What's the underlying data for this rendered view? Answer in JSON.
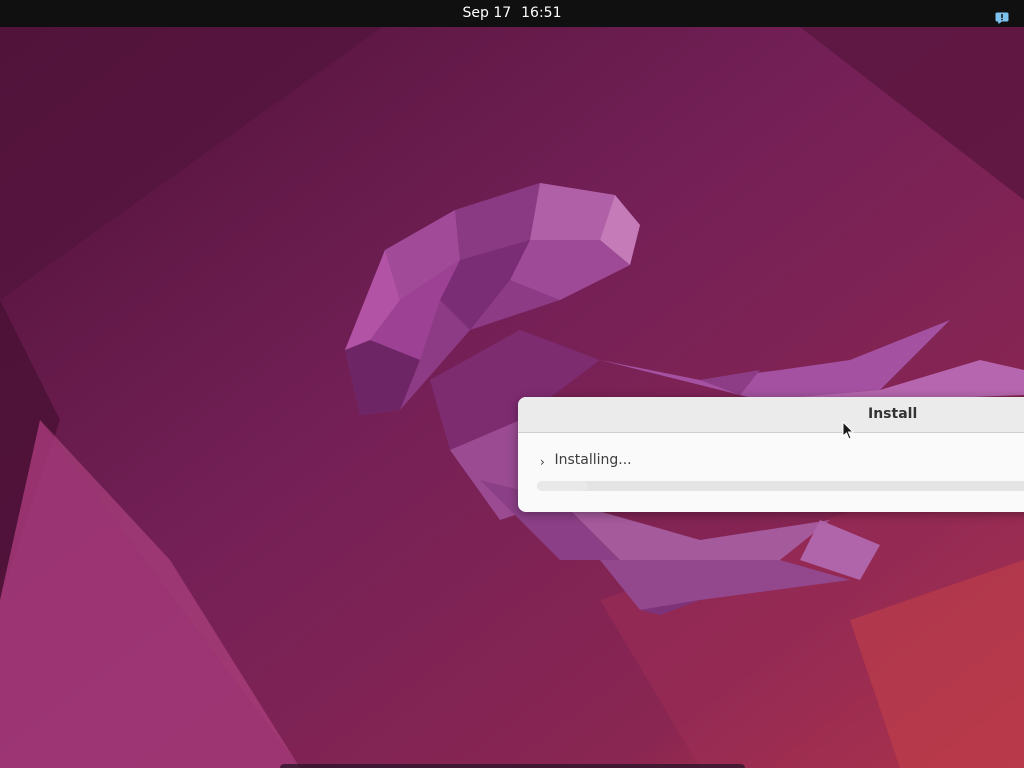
{
  "topbar": {
    "date": "Sep 17",
    "time": "16:51",
    "notification_icon": "notification-icon",
    "background": "#101010"
  },
  "wallpaper": {
    "subject": "jellyfish",
    "base_color": "#6e1f55"
  },
  "dialog": {
    "title": "Install",
    "expander_arrow": "›",
    "status": "Installing...",
    "progress_fraction": 0.1
  }
}
